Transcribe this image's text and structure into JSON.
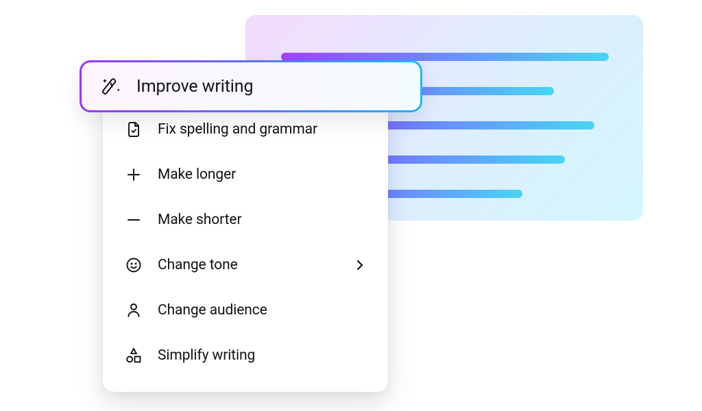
{
  "menu": {
    "highlighted": {
      "label": "Improve writing",
      "icon": "magic-wand-icon"
    },
    "items": [
      {
        "label": "Fix spelling and grammar",
        "icon": "document-check-icon",
        "submenu": false
      },
      {
        "label": "Make longer",
        "icon": "plus-icon",
        "submenu": false
      },
      {
        "label": "Make shorter",
        "icon": "minus-icon",
        "submenu": false
      },
      {
        "label": "Change tone",
        "icon": "smile-icon",
        "submenu": true
      },
      {
        "label": "Change audience",
        "icon": "person-icon",
        "submenu": false
      },
      {
        "label": "Simplify writing",
        "icon": "shapes-icon",
        "submenu": false
      }
    ]
  },
  "colors": {
    "gradient_from": "#9a34ff",
    "gradient_mid": "#5e6cff",
    "gradient_to": "#19b9ff",
    "text": "#111217"
  }
}
